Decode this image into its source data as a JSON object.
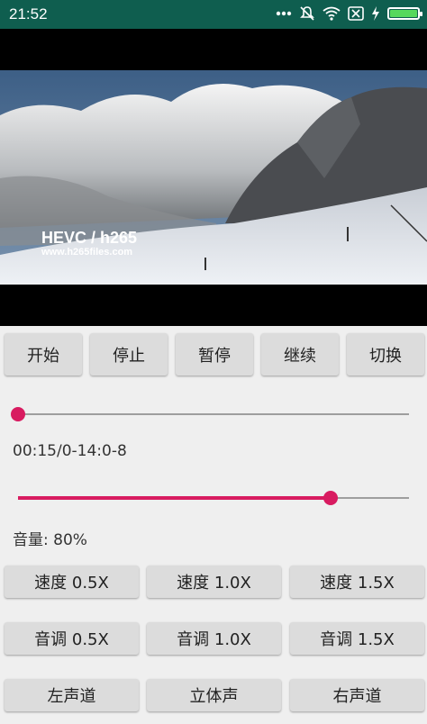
{
  "status_bar": {
    "time": "21:52",
    "battery_level": 1.0
  },
  "video": {
    "overlay_title": "HEVC / h265",
    "overlay_url": "www.h265files.com"
  },
  "controls": {
    "start": "开始",
    "stop": "停止",
    "pause": "暂停",
    "resume": "继续",
    "switch": "切换"
  },
  "playback": {
    "progress": 0.0,
    "time_text": "00:15/0-14:0-8"
  },
  "volume": {
    "level": 0.8,
    "label": "音量: 80%"
  },
  "speed": [
    "速度 0.5X",
    "速度 1.0X",
    "速度 1.5X"
  ],
  "pitch": [
    "音调 0.5X",
    "音调 1.0X",
    "音调 1.5X"
  ],
  "channels": [
    "左声道",
    "立体声",
    "右声道"
  ],
  "colors": {
    "accent": "#d81b60",
    "status_bar": "#0f5e4f"
  }
}
